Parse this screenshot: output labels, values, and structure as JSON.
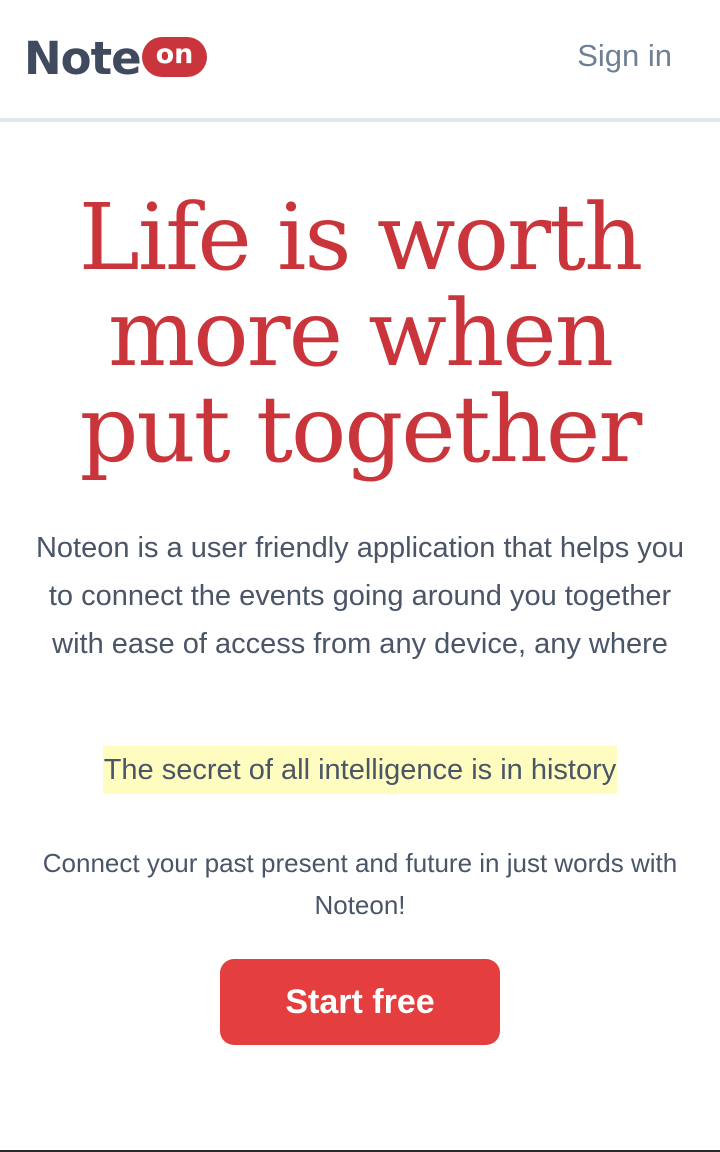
{
  "header": {
    "logo_text": "Note",
    "logo_badge": "on",
    "signin_label": "Sign in"
  },
  "hero": {
    "title_line1": "Life is worth",
    "title_line2": "more when",
    "title_line3": "put together",
    "description": "Noteon is a user friendly application that helps you to connect the events going around you together with ease of access from any device, any where",
    "quote": "The secret of all intelligence is in history",
    "connect_text": "Connect your past present and future in just words with Noteon!",
    "cta_label": "Start free"
  },
  "colors": {
    "brand_red": "#c9353a",
    "button_red": "#e53e3e",
    "highlight": "#fefcbf",
    "text": "#4a5568",
    "muted": "#6f8094"
  }
}
